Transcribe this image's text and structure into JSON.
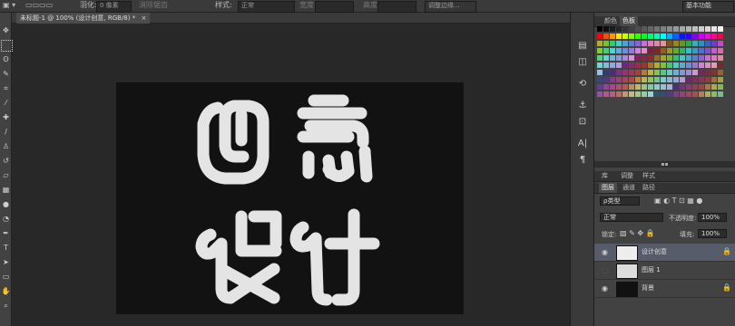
{
  "options_bar": {
    "feather_label": "羽化:",
    "feather_value": "0 像素",
    "anti_alias": "消除锯齿",
    "style_label": "样式:",
    "style_value": "正常",
    "width_label": "宽度:",
    "height_label": "高度:",
    "refine_edge": "调整边缘...",
    "workspace": "基本功能"
  },
  "document": {
    "tab_title": "未标题-1 @ 100% (设计创意, RGB/8) *",
    "artwork_text": [
      "创",
      "意",
      "设",
      "计"
    ]
  },
  "swatch_panel": {
    "tabs": [
      "颜色",
      "色板"
    ],
    "active_tab": "色板"
  },
  "layers_panel": {
    "tabs": [
      "图层",
      "通道",
      "路径"
    ],
    "top_tabs": [
      "库",
      "调整",
      "样式"
    ],
    "filter_label": "ρ类型",
    "blend_mode": "正常",
    "opacity_label": "不透明度:",
    "opacity_value": "100%",
    "lock_label": "锁定:",
    "fill_label": "填充:",
    "fill_value": "100%",
    "layers": [
      {
        "name": "设计创意",
        "visible": true,
        "selected": true
      },
      {
        "name": "图层 1",
        "visible": false,
        "selected": false
      },
      {
        "name": "背景",
        "visible": true,
        "selected": false
      }
    ]
  },
  "colors": {
    "canvas_bg": "#121212",
    "artwork": "#e4e4e4",
    "selected_layer": "#575c6a"
  }
}
